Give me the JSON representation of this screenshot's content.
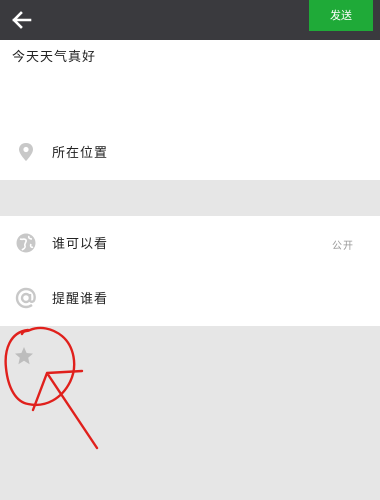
{
  "header": {
    "back_icon": "arrow-left-icon",
    "send_label": "发送",
    "send_color": "#1faa38",
    "bar_color": "#3a3a3e"
  },
  "compose": {
    "text": "今天天气真好"
  },
  "options": {
    "location": {
      "icon": "location-pin-icon",
      "label": "所在位置"
    },
    "visibility": {
      "icon": "globe-icon",
      "label": "谁可以看",
      "value": "公开"
    },
    "mention": {
      "icon": "at-icon",
      "label": "提醒谁看"
    }
  },
  "favorite": {
    "icon": "star-icon"
  },
  "annotation": {
    "color": "#e0201c",
    "shape": "hand-drawn circle with arrow"
  }
}
